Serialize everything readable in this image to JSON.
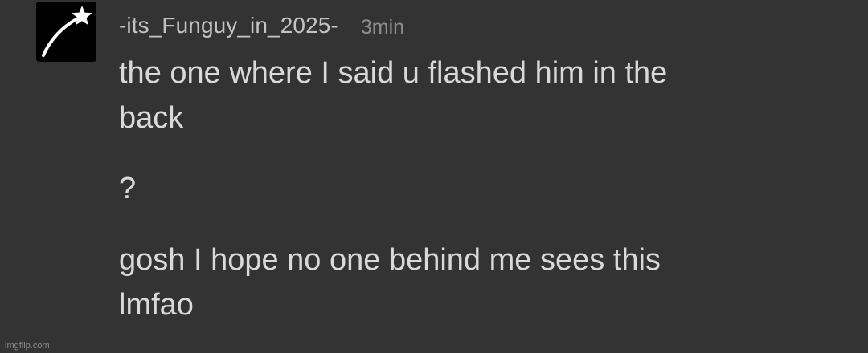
{
  "comment": {
    "avatar_icon": "shooting-star-icon",
    "username": "-its_Funguy_in_2025-",
    "time": "3min",
    "messages": [
      "the one where I said u flashed him in the\nback",
      "?",
      "gosh I hope no one behind me sees this\nlmfao"
    ]
  },
  "watermark": "imgflip.com",
  "colors": {
    "background": "#333333",
    "avatar_bg": "#000000",
    "text": "#d9d9d9",
    "username": "#c3c3c3",
    "time": "#8e8e8e"
  }
}
